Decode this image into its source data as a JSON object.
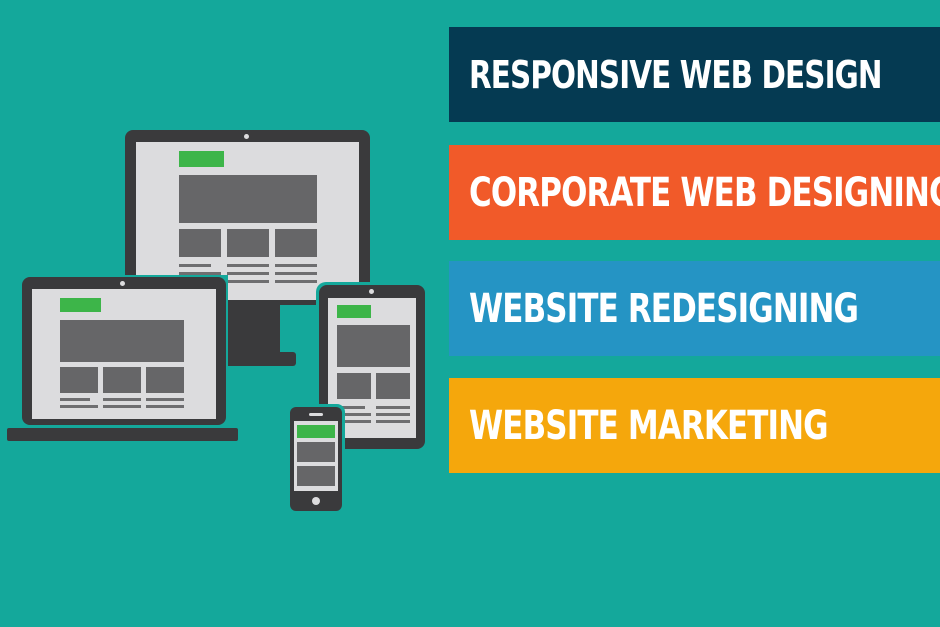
{
  "services": [
    {
      "label": "RESPONSIVE WEB DESIGN",
      "color": "#053a52"
    },
    {
      "label": "CORPORATE WEB DESIGNING",
      "color": "#f15a29"
    },
    {
      "label": "WEBSITE REDESIGNING",
      "color": "#2594c4"
    },
    {
      "label": "WEBSITE MARKETING",
      "color": "#f5a70c"
    }
  ],
  "theme": {
    "background": "#14a89b",
    "device_frame": "#3a3a3c",
    "screen": "#dcdcde",
    "accent_button": "#3db549"
  },
  "devices": [
    "desktop-monitor",
    "laptop",
    "tablet",
    "smartphone"
  ]
}
